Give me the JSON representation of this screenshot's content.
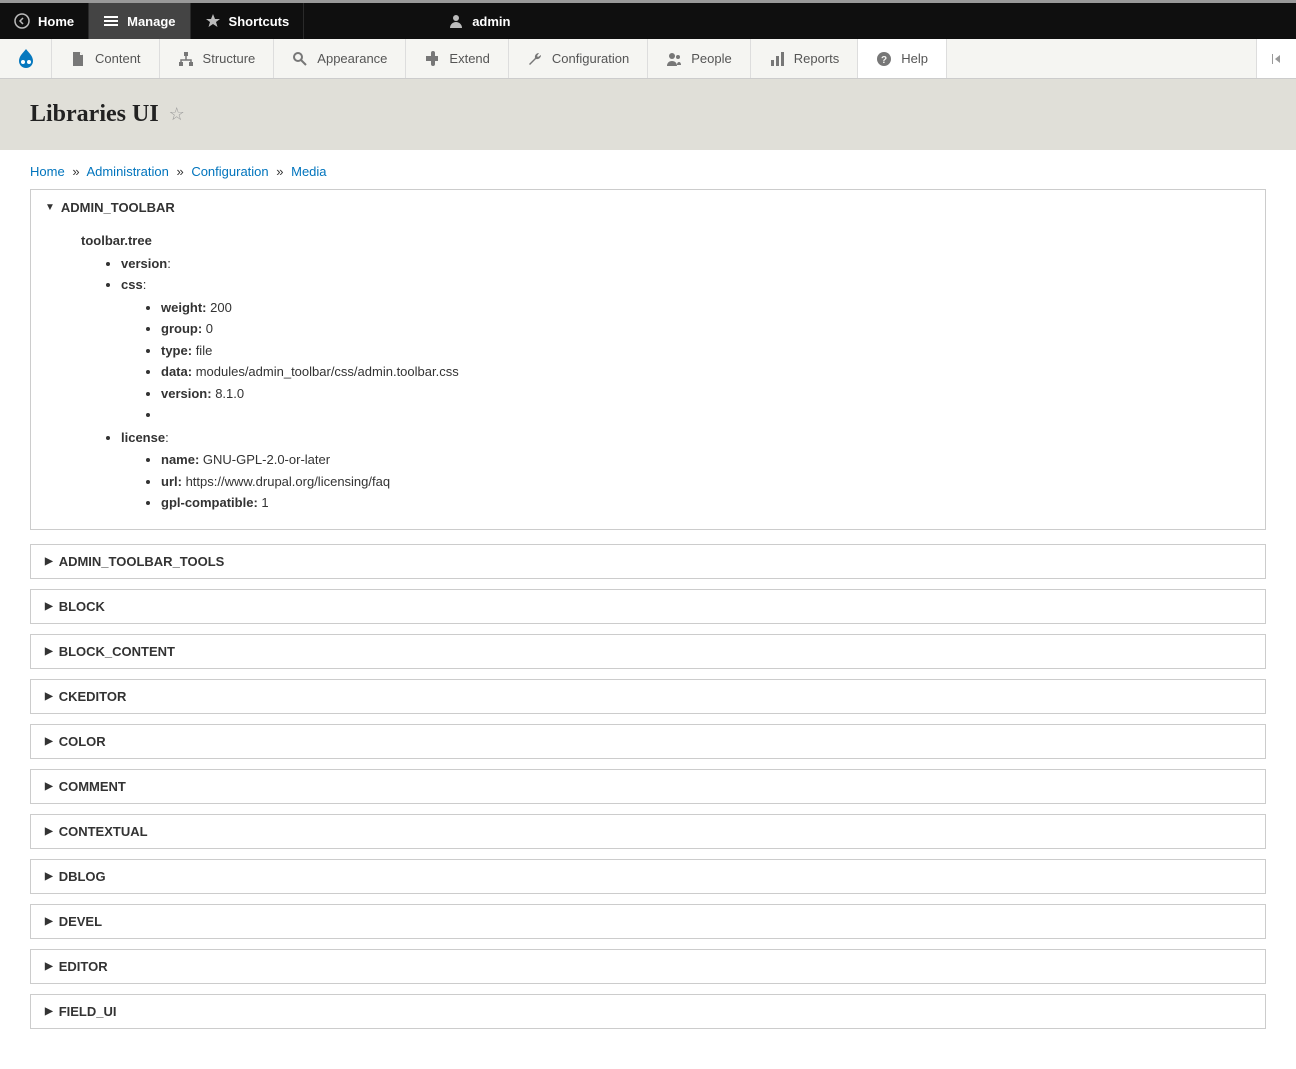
{
  "toolbar_top": {
    "home": "Home",
    "manage": "Manage",
    "shortcuts": "Shortcuts",
    "user": "admin"
  },
  "toolbar_admin": {
    "content": "Content",
    "structure": "Structure",
    "appearance": "Appearance",
    "extend": "Extend",
    "configuration": "Configuration",
    "people": "People",
    "reports": "Reports",
    "help": "Help"
  },
  "page_title": "Libraries UI",
  "breadcrumb": {
    "home": "Home",
    "admin": "Administration",
    "config": "Configuration",
    "media": "Media"
  },
  "expanded": {
    "title": "ADMIN_TOOLBAR",
    "tree_name": "toolbar.tree",
    "l1_version_label": "version",
    "l1_css_label": "css",
    "css_weight_label": "weight:",
    "css_weight_value": "200",
    "css_group_label": "group:",
    "css_group_value": "0",
    "css_type_label": "type:",
    "css_type_value": "file",
    "css_data_label": "data:",
    "css_data_value": "modules/admin_toolbar/css/admin.toolbar.css",
    "css_version_label": "version:",
    "css_version_value": "8.1.0",
    "l1_license_label": "license",
    "lic_name_label": "name:",
    "lic_name_value": "GNU-GPL-2.0-or-later",
    "lic_url_label": "url:",
    "lic_url_value": "https://www.drupal.org/licensing/faq",
    "lic_gpl_label": "gpl-compatible:",
    "lic_gpl_value": "1"
  },
  "collapsed": [
    "ADMIN_TOOLBAR_TOOLS",
    "BLOCK",
    "BLOCK_CONTENT",
    "CKEDITOR",
    "COLOR",
    "COMMENT",
    "CONTEXTUAL",
    "DBLOG",
    "DEVEL",
    "EDITOR",
    "FIELD_UI"
  ]
}
